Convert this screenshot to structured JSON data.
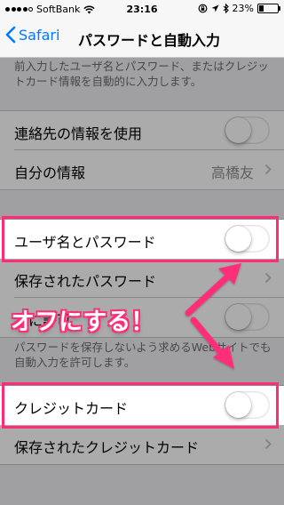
{
  "status": {
    "carrier": "SoftBank",
    "time": "23:16",
    "battery": "23%",
    "battery_level": 0.23
  },
  "nav": {
    "back_label": "Safari",
    "title": "パスワードと自動入力"
  },
  "top_note": "前入力したユーザ名とパスワード、またはクレジットカード情報を自動的に入力します。",
  "rows": {
    "contacts": {
      "label": "連絡先の情報を使用"
    },
    "my_info": {
      "label": "自分の情報",
      "value": "高橋友"
    },
    "names_passwords": {
      "label": "ユーザ名とパスワード"
    },
    "saved_passwords": {
      "label": "保存されたパスワード"
    },
    "always_allow": {
      "label": "常に許可"
    },
    "credit_cards": {
      "label": "クレジットカード"
    },
    "saved_cards": {
      "label": "保存されたクレジットカード"
    }
  },
  "mid_note": "パスワードを保存しないよう求めるWebサイトでも自動入力を許可します。",
  "callout": "オフにする！",
  "colors": {
    "accent": "#007aff",
    "highlight": "#ff2d78"
  }
}
